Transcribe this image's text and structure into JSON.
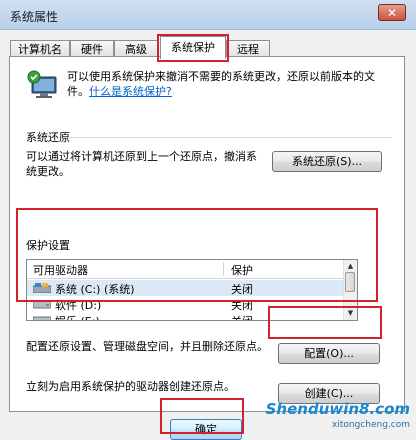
{
  "window": {
    "title": "系统属性",
    "close_glyph": "✕"
  },
  "tabs": [
    {
      "label": "计算机名",
      "active": false
    },
    {
      "label": "硬件",
      "active": false
    },
    {
      "label": "高级",
      "active": false
    },
    {
      "label": "系统保护",
      "active": true
    },
    {
      "label": "远程",
      "active": false
    }
  ],
  "intro": {
    "text": "可以使用系统保护来撤消不需要的系统更改，还原以前版本的文件。",
    "link": "什么是系统保护?"
  },
  "restore": {
    "section": "系统还原",
    "desc": "可以通过将计算机还原到上一个还原点，撤消系统更改。",
    "button": "系统还原(S)..."
  },
  "protection": {
    "section": "保护设置",
    "columns": [
      "可用驱动器",
      "保护"
    ],
    "rows": [
      {
        "drive": "系统 (C:) (系统)",
        "status": "关闭",
        "icon": "system-drive-icon"
      },
      {
        "drive": "软件 (D:)",
        "status": "关闭",
        "icon": "drive-icon"
      },
      {
        "drive": "娱乐 (E:)",
        "status": "关闭",
        "icon": "drive-icon"
      }
    ]
  },
  "configure": {
    "desc": "配置还原设置、管理磁盘空间，并且删除还原点。",
    "button": "配置(O)..."
  },
  "create": {
    "desc": "立刻为启用系统保护的驱动器创建还原点。",
    "button": "创建(C)..."
  },
  "footer": {
    "ok": "确定"
  },
  "watermark": {
    "line1": "Shenduwin8.com",
    "line2": "xitongcheng.com"
  },
  "colors": {
    "highlight": "#d2232a",
    "link": "#0066cc"
  }
}
